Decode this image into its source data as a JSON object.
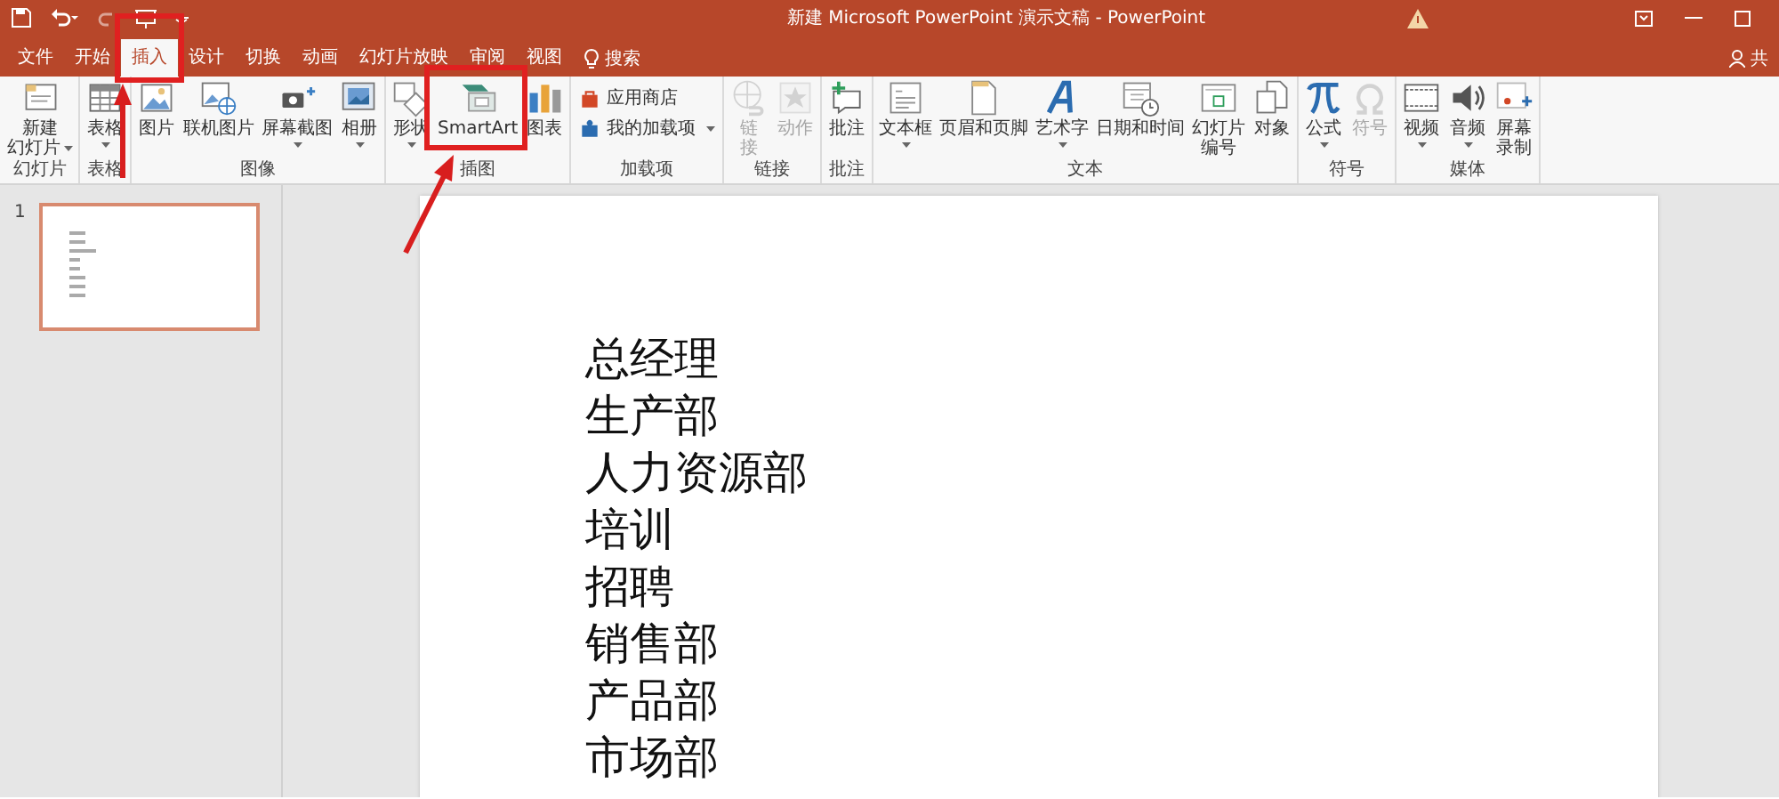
{
  "window": {
    "title": "新建 Microsoft PowerPoint 演示文稿 - PowerPoint"
  },
  "tabs": [
    {
      "label": "文件",
      "selected": false
    },
    {
      "label": "开始",
      "selected": false
    },
    {
      "label": "插入",
      "selected": true
    },
    {
      "label": "设计",
      "selected": false
    },
    {
      "label": "切换",
      "selected": false
    },
    {
      "label": "动画",
      "selected": false
    },
    {
      "label": "幻灯片放映",
      "selected": false
    },
    {
      "label": "审阅",
      "selected": false
    },
    {
      "label": "视图",
      "selected": false
    }
  ],
  "search": {
    "label": "搜索"
  },
  "share": {
    "label": "共"
  },
  "ribbon": {
    "groups": [
      {
        "label": "幻灯片",
        "buttons": [
          {
            "kind": "large",
            "label_lines": [
              "新建",
              "幻灯片"
            ],
            "dropdown": true,
            "disabled": false
          }
        ]
      },
      {
        "label": "表格",
        "buttons": [
          {
            "kind": "large",
            "label_lines": [
              "表格"
            ],
            "dropdown": true,
            "disabled": false
          }
        ]
      },
      {
        "label": "图像",
        "buttons": [
          {
            "kind": "large",
            "label_lines": [
              "图片"
            ],
            "dropdown": false,
            "disabled": false
          },
          {
            "kind": "large",
            "label_lines": [
              "联机图片"
            ],
            "dropdown": false,
            "disabled": false
          },
          {
            "kind": "large",
            "label_lines": [
              "屏幕截图"
            ],
            "dropdown": true,
            "disabled": false
          },
          {
            "kind": "large",
            "label_lines": [
              "相册"
            ],
            "dropdown": true,
            "disabled": false
          }
        ]
      },
      {
        "label": "插图",
        "buttons": [
          {
            "kind": "large",
            "label_lines": [
              "形状"
            ],
            "dropdown": true,
            "disabled": false
          },
          {
            "kind": "large",
            "label_lines": [
              "SmartArt"
            ],
            "dropdown": false,
            "disabled": false
          },
          {
            "kind": "large",
            "label_lines": [
              "图表"
            ],
            "dropdown": false,
            "disabled": false
          }
        ]
      },
      {
        "label": "加载项",
        "buttons": [
          {
            "kind": "small",
            "label_lines": [
              "应用商店"
            ],
            "dropdown": false,
            "disabled": false
          },
          {
            "kind": "small",
            "label_lines": [
              "我的加载项"
            ],
            "dropdown": true,
            "disabled": false
          }
        ]
      },
      {
        "label": "链接",
        "buttons": [
          {
            "kind": "large",
            "label_lines": [
              "链",
              "接"
            ],
            "dropdown": false,
            "disabled": true
          },
          {
            "kind": "large",
            "label_lines": [
              "动作"
            ],
            "dropdown": false,
            "disabled": true
          }
        ]
      },
      {
        "label": "批注",
        "buttons": [
          {
            "kind": "large",
            "label_lines": [
              "批注"
            ],
            "dropdown": false,
            "disabled": false
          }
        ]
      },
      {
        "label": "文本",
        "buttons": [
          {
            "kind": "large",
            "label_lines": [
              "文本框"
            ],
            "dropdown": true,
            "disabled": false
          },
          {
            "kind": "large",
            "label_lines": [
              "页眉和页脚"
            ],
            "dropdown": false,
            "disabled": false
          },
          {
            "kind": "large",
            "label_lines": [
              "艺术字"
            ],
            "dropdown": true,
            "disabled": false
          },
          {
            "kind": "large",
            "label_lines": [
              "日期和时间"
            ],
            "dropdown": false,
            "disabled": false
          },
          {
            "kind": "large",
            "label_lines": [
              "幻灯片",
              "编号"
            ],
            "dropdown": false,
            "disabled": false
          },
          {
            "kind": "large",
            "label_lines": [
              "对象"
            ],
            "dropdown": false,
            "disabled": false
          }
        ]
      },
      {
        "label": "符号",
        "buttons": [
          {
            "kind": "large",
            "label_lines": [
              "公式"
            ],
            "dropdown": true,
            "disabled": false
          },
          {
            "kind": "large",
            "label_lines": [
              "符号"
            ],
            "dropdown": false,
            "disabled": true
          }
        ]
      },
      {
        "label": "媒体",
        "buttons": [
          {
            "kind": "large",
            "label_lines": [
              "视频"
            ],
            "dropdown": true,
            "disabled": false
          },
          {
            "kind": "large",
            "label_lines": [
              "音频"
            ],
            "dropdown": true,
            "disabled": false
          },
          {
            "kind": "large",
            "label_lines": [
              "屏幕",
              "录制"
            ],
            "dropdown": false,
            "disabled": false
          }
        ]
      }
    ]
  },
  "thumbnails": [
    {
      "number": "1",
      "selected": true
    }
  ],
  "slide": {
    "lines": [
      "总经理",
      "生产部",
      "人力资源部",
      "培训",
      "招聘",
      "销售部",
      "产品部",
      "市场部"
    ]
  }
}
